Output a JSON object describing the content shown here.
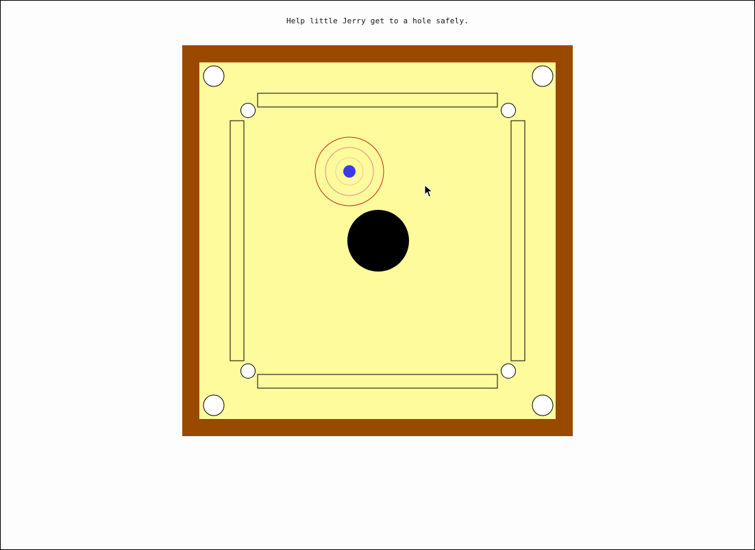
{
  "instruction_text": "Help little Jerry get to a hole safely.",
  "colors": {
    "frame": "#9a4a00",
    "board": "#fdfb9c",
    "jerry": "#3a3ae8",
    "target_ring_outer": "#cc2222",
    "target_ring_middle": "#e08a8a",
    "target_ring_inner": "#f0c8a0",
    "obstacle": "#000000",
    "hole": "#ffffff",
    "outline": "#000000"
  },
  "icons": {
    "jerry": "blue-dot",
    "hole": "white-circle",
    "obstacle": "black-disk",
    "cursor": "arrow-pointer"
  }
}
